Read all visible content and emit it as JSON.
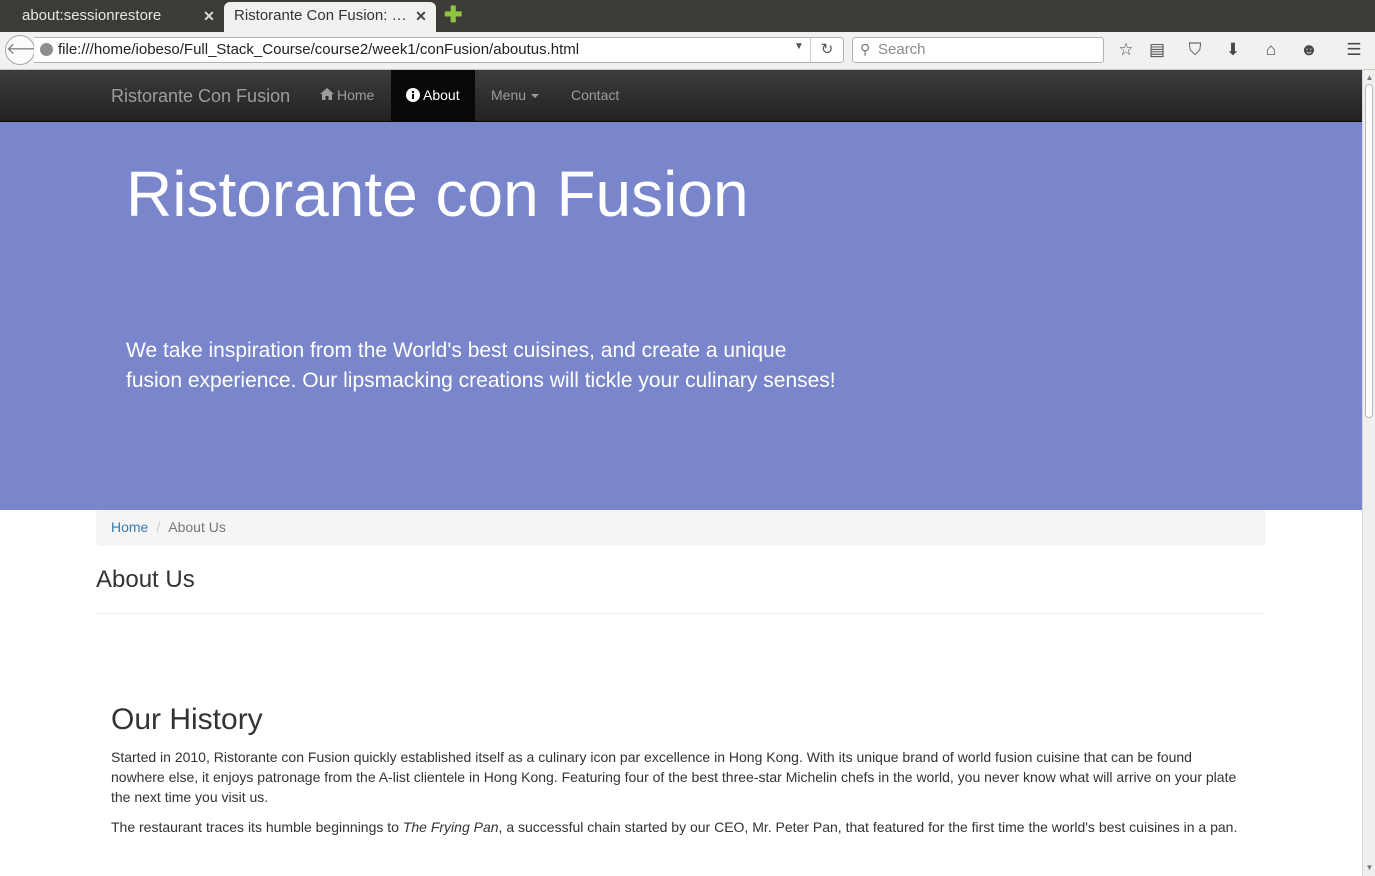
{
  "browser": {
    "tabs": [
      {
        "title": "about:sessionrestore",
        "active": false
      },
      {
        "title": "Ristorante Con Fusion: …",
        "active": true
      }
    ],
    "new_tab_glyph": "✚",
    "url": "file:///home/iobeso/Full_Stack_Course/course2/week1/conFusion/aboutus.html",
    "search_placeholder": "Search",
    "toolbar_icons": [
      "bookmark-star-icon",
      "reading-list-icon",
      "pocket-icon",
      "download-icon",
      "home-icon",
      "chat-icon",
      "hamburger-menu-icon"
    ]
  },
  "site": {
    "brand": "Ristorante Con Fusion",
    "nav": {
      "home": "Home",
      "about": "About",
      "menu": "Menu",
      "contact": "Contact",
      "active": "About"
    }
  },
  "jumbotron": {
    "title": "Ristorante con Fusion",
    "text": "We take inspiration from the World's best cuisines, and create a unique fusion experience. Our lipsmacking creations will tickle your culinary senses!",
    "background": "#7986cb"
  },
  "breadcrumb": {
    "home": "Home",
    "separator": "/",
    "current": "About Us"
  },
  "page_title": "About Us",
  "history": {
    "title": "Our History",
    "para1": "Started in 2010, Ristorante con Fusion quickly established itself as a culinary icon par excellence in Hong Kong. With its unique brand of world fusion cuisine that can be found nowhere else, it enjoys patronage from the A-list clientele in Hong Kong. Featuring four of the best three-star Michelin chefs in the world, you never know what will arrive on your plate the next time you visit us.",
    "para2_before": "The restaurant traces its humble beginnings to ",
    "para2_em": "The Frying Pan",
    "para2_after": ", a successful chain started by our CEO, Mr. Peter Pan, that featured for the first time the world's best cuisines in a pan."
  },
  "colors": {
    "navbar": "#222222",
    "link": "#337ab7",
    "text": "#333333"
  }
}
